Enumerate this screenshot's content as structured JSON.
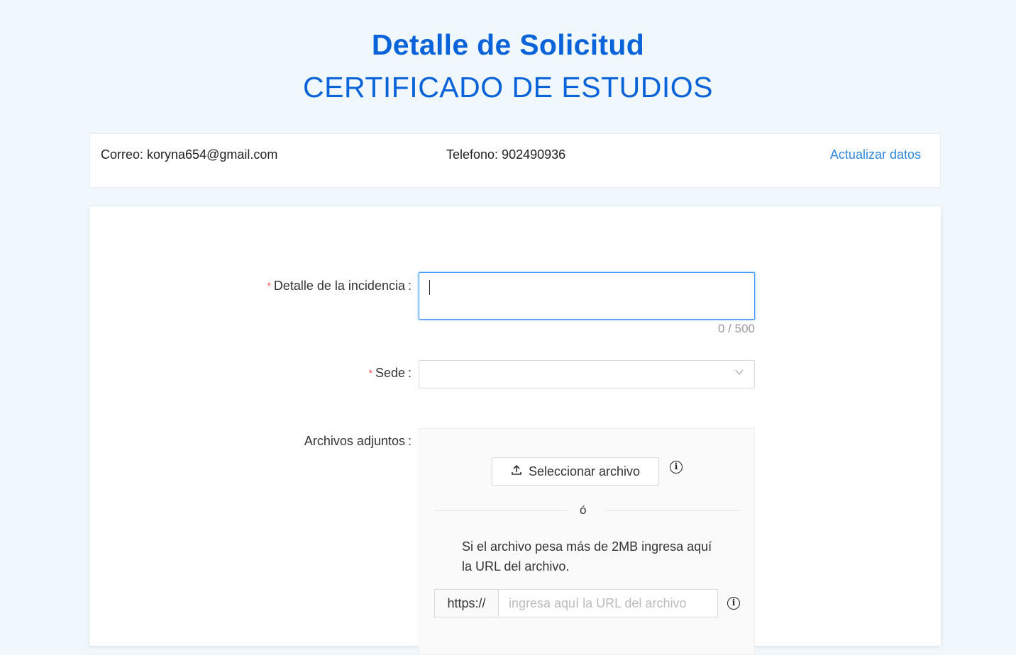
{
  "header": {
    "title": "Detalle de Solicitud",
    "subtitle": "CERTIFICADO DE ESTUDIOS"
  },
  "contact": {
    "email": "Correo: koryna654@gmail.com",
    "phone": "Telefono: 902490936",
    "update_link": "Actualizar datos"
  },
  "form": {
    "detail": {
      "label": "Detalle de la incidencia",
      "value": "",
      "counter": "0 / 500"
    },
    "sede": {
      "label": "Sede",
      "value": ""
    },
    "attachments": {
      "label": "Archivos adjuntos",
      "select_button": "Seleccionar archivo",
      "divider": "ó",
      "hint": "Si el archivo pesa más de 2MB ingresa aquí la URL del archivo.",
      "url_prefix": "https://",
      "url_placeholder": "ingresa aquí la URL del archivo"
    }
  },
  "colors": {
    "brand": "#0a63d9",
    "link": "#2f86de",
    "required": "#ff4d4f",
    "background": "#f0f8fe"
  },
  "icons": [
    "upload-icon",
    "info-icon",
    "chevron-down-icon"
  ]
}
